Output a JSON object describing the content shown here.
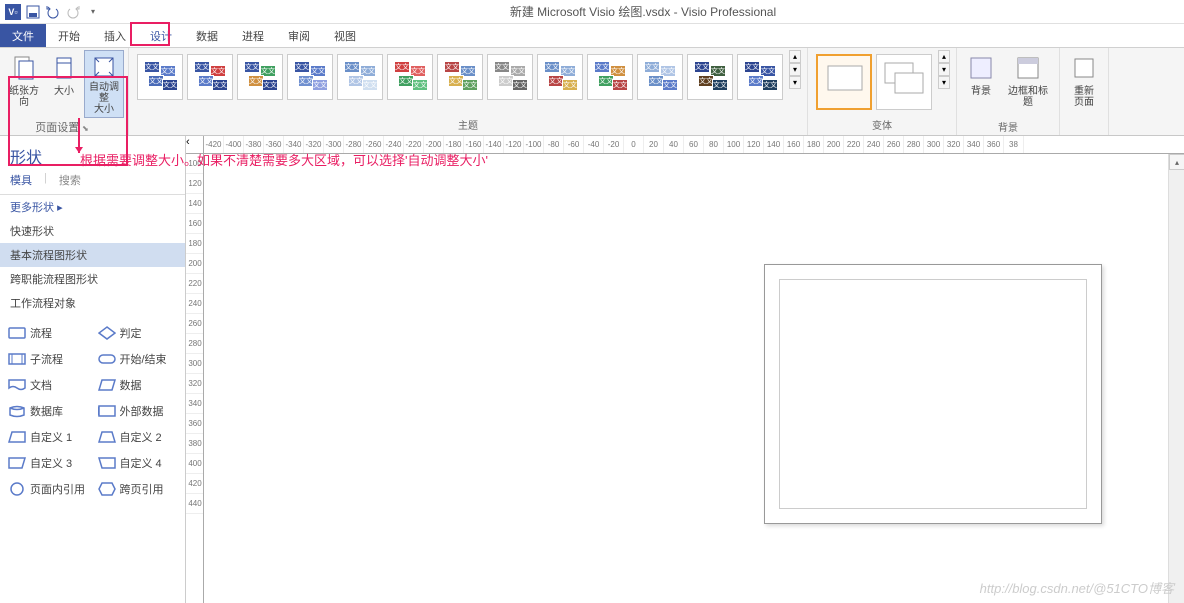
{
  "titlebar": {
    "title": "新建 Microsoft Visio 绘图.vsdx - Visio Professional"
  },
  "tabs": {
    "file": "文件",
    "start": "开始",
    "insert": "插入",
    "design": "设计",
    "data": "数据",
    "process": "进程",
    "review": "审阅",
    "view": "视图"
  },
  "ribbon": {
    "page_setup": {
      "label": "页面设置",
      "orientation": "纸张方向",
      "size": "大小",
      "autosize": "自动调整\n大小"
    },
    "themes": {
      "label": "主题",
      "thumb_text": "文文"
    },
    "variants": {
      "label": "变体"
    },
    "backgrounds": {
      "label": "背景",
      "bg": "背景",
      "borders": "边框和标题",
      "relay": "重新\n页面"
    }
  },
  "shapes": {
    "title": "形状",
    "tabs": {
      "stencils": "模具",
      "search": "搜索"
    },
    "cats": {
      "more": "更多形状",
      "quick": "快速形状",
      "basic": "基本流程图形状",
      "cross": "跨职能流程图形状",
      "work": "工作流程对象"
    },
    "items": [
      {
        "n": "流程"
      },
      {
        "n": "判定"
      },
      {
        "n": "子流程"
      },
      {
        "n": "开始/结束"
      },
      {
        "n": "文档"
      },
      {
        "n": "数据"
      },
      {
        "n": "数据库"
      },
      {
        "n": "外部数据"
      },
      {
        "n": "自定义 1"
      },
      {
        "n": "自定义 2"
      },
      {
        "n": "自定义 3"
      },
      {
        "n": "自定义 4"
      },
      {
        "n": "页面内引用"
      },
      {
        "n": "跨页引用"
      }
    ]
  },
  "ruler_h": [
    "-420",
    "-400",
    "-380",
    "-360",
    "-340",
    "-320",
    "-300",
    "-280",
    "-260",
    "-240",
    "-220",
    "-200",
    "-180",
    "-160",
    "-140",
    "-120",
    "-100",
    "-80",
    "-60",
    "-40",
    "-20",
    "0",
    "20",
    "40",
    "60",
    "80",
    "100",
    "120",
    "140",
    "160",
    "180",
    "200",
    "220",
    "240",
    "260",
    "280",
    "300",
    "320",
    "340",
    "360",
    "38"
  ],
  "ruler_v": [
    "100",
    "120",
    "140",
    "160",
    "180",
    "200",
    "220",
    "240",
    "260",
    "280",
    "300",
    "320",
    "340",
    "360",
    "380",
    "400",
    "420",
    "440"
  ],
  "annotation": "根据需要调整大小。如果不清楚需要多大区域，可以选择'自动调整大小'",
  "watermark": "http://blog.csdn.net/@51CTO博客"
}
